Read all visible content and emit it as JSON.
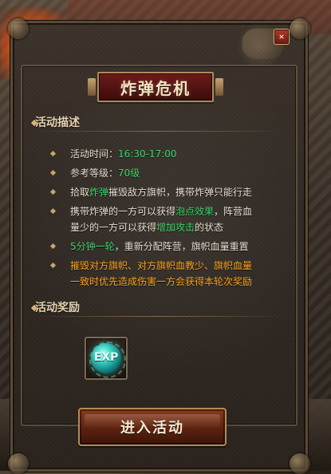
{
  "window": {
    "title": "炸弹危机",
    "close_label": "×"
  },
  "sections": {
    "description": {
      "title": "活动描述",
      "items": [
        {
          "prefix": "活动时间：",
          "value": "16:30-17:00"
        },
        {
          "prefix": "参考等级：",
          "value": "70级"
        },
        {
          "text1": "拾取",
          "hl1": "炸弹",
          "text2": "摧毁敌方旗帜，携带炸弹只能行走"
        },
        {
          "line1_a": "携带炸弹的一方可以获得",
          "line1_hl": "泡点效果",
          "line1_b": "，阵营血"
        },
        {
          "line2_a": "量少的一方可以获得",
          "line2_hl": "增加攻击",
          "line2_b": "的状态"
        },
        {
          "hl": "5分钟一轮",
          "text": "，重新分配阵营，旗帜血量重置"
        },
        {
          "orange1": "摧毁对方旗帜、对方旗帜血教少、旗帜血量"
        },
        {
          "orange2": "一致时优先造成伤害一方会获得本轮次奖励"
        }
      ]
    },
    "reward": {
      "title": "活动奖励",
      "items": [
        {
          "icon": "exp-icon",
          "label": "EXP"
        }
      ]
    }
  },
  "buttons": {
    "enter_label": "进入活动"
  },
  "colors": {
    "green": "#3fd56a",
    "orange": "#ffa31a",
    "text": "#e8dfd0",
    "gold": "#b38a55"
  }
}
